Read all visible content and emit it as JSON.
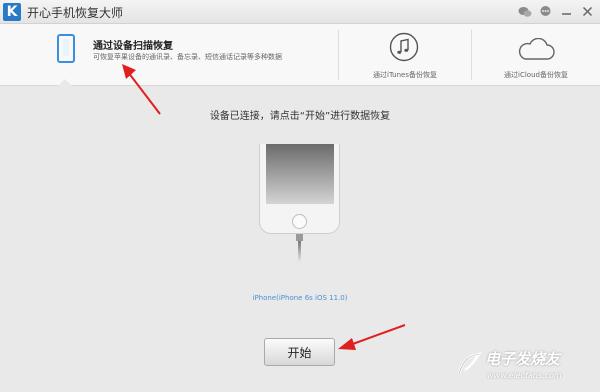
{
  "window": {
    "logo": "K",
    "title": "开心手机恢复大师"
  },
  "tabs": {
    "scan": {
      "title": "通过设备扫描恢复",
      "desc": "可恢复苹果设备的通讯录、备忘录、短信通话记录等多种数据"
    },
    "itunes": {
      "label": "通过iTunes备份恢复"
    },
    "icloud": {
      "label": "通过iCloud备份恢复"
    }
  },
  "main": {
    "prompt": "设备已连接，请点击“开始”进行数据恢复",
    "device_label": "iPhone(iPhone 6s iOS 11.0)",
    "start_button": "开始"
  },
  "watermark": {
    "text": "电子发烧友",
    "url": "www.elecfans.com"
  },
  "colors": {
    "accent": "#3a8ee0",
    "arrow": "#e02020",
    "background": "#e9e9e9"
  }
}
